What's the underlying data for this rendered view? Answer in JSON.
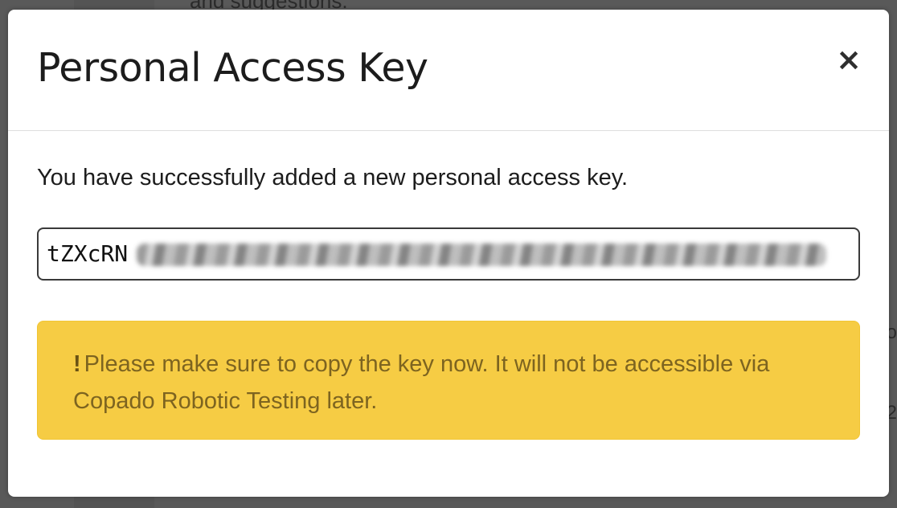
{
  "background": {
    "top_text": "and suggestions.",
    "frag_1": "o",
    "frag_2": "2"
  },
  "modal": {
    "title": "Personal Access Key",
    "close_label": "×",
    "success_message": "You have successfully added a new personal access key.",
    "key_value_visible": "tZXcRN",
    "warning": {
      "icon": "exclamation-icon",
      "icon_glyph": "!",
      "text": "Please make sure to copy the key now. It will not be accessible via Copado Robotic Testing later."
    }
  },
  "colors": {
    "warning_bg": "#f6cc44",
    "warning_text": "#7d6420",
    "backdrop": "#595959"
  }
}
